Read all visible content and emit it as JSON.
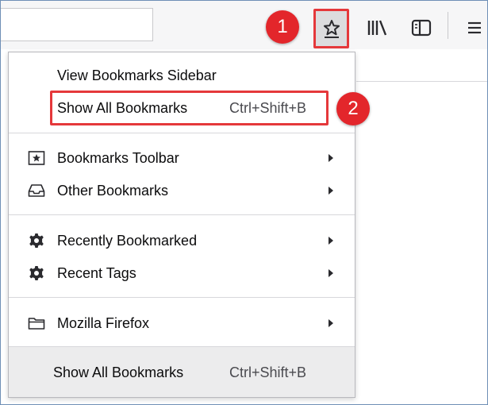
{
  "toolbar": {
    "buttons": [
      {
        "name": "star-icon",
        "label": "Bookmarks menu"
      },
      {
        "name": "library-icon",
        "label": "Library"
      },
      {
        "name": "sidebar-icon",
        "label": "Sidebars"
      },
      {
        "name": "hamburger-icon",
        "label": "Open menu"
      }
    ]
  },
  "annotations": {
    "step1": "1",
    "step2": "2",
    "color": "#e3262b"
  },
  "menu": {
    "view_sidebar": "View Bookmarks Sidebar",
    "show_all": {
      "label": "Show All Bookmarks",
      "shortcut": "Ctrl+Shift+B"
    },
    "bookmarks_toolbar": {
      "label": "Bookmarks Toolbar",
      "icon": "star-in-box-icon"
    },
    "other_bookmarks": {
      "label": "Other Bookmarks",
      "icon": "tray-icon"
    },
    "recently_bookmarked": {
      "label": "Recently Bookmarked",
      "icon": "gear-icon"
    },
    "recent_tags": {
      "label": "Recent Tags",
      "icon": "gear-icon"
    },
    "mozilla_firefox": {
      "label": "Mozilla Firefox",
      "icon": "folder-icon"
    },
    "footer": {
      "label": "Show All Bookmarks",
      "shortcut": "Ctrl+Shift+B"
    }
  },
  "colors": {
    "accent_red": "#e5383b",
    "toolbar_bg": "#f6f6f7",
    "footer_bg": "#ececed"
  }
}
